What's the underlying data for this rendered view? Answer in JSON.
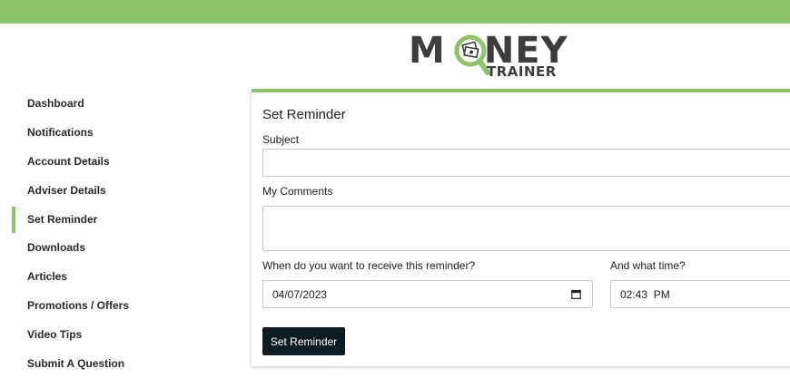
{
  "brand": {
    "logo_word_1": "M",
    "logo_word_2": "NEY",
    "logo_sub": "TRAINER",
    "accent_color": "#8bc46a",
    "logo_icon": "magnifying-glass-money-icon"
  },
  "sidebar": {
    "items": [
      {
        "label": "Dashboard",
        "active": false
      },
      {
        "label": "Notifications",
        "active": false
      },
      {
        "label": "Account Details",
        "active": false
      },
      {
        "label": "Adviser Details",
        "active": false
      },
      {
        "label": "Set Reminder",
        "active": true
      },
      {
        "label": "Downloads",
        "active": false
      },
      {
        "label": "Articles",
        "active": false
      },
      {
        "label": "Promotions / Offers",
        "active": false
      },
      {
        "label": "Video Tips",
        "active": false
      },
      {
        "label": "Submit A Question",
        "active": false
      }
    ]
  },
  "form": {
    "title": "Set Reminder",
    "subject_label": "Subject",
    "subject_value": "",
    "comments_label": "My Comments",
    "comments_value": "",
    "date_label": "When do you want to receive this reminder?",
    "date_value": "04/07/2023",
    "time_label": "And what time?",
    "time_value": "02:43  PM",
    "submit_label": "Set Reminder",
    "date_icon": "calendar-icon"
  }
}
